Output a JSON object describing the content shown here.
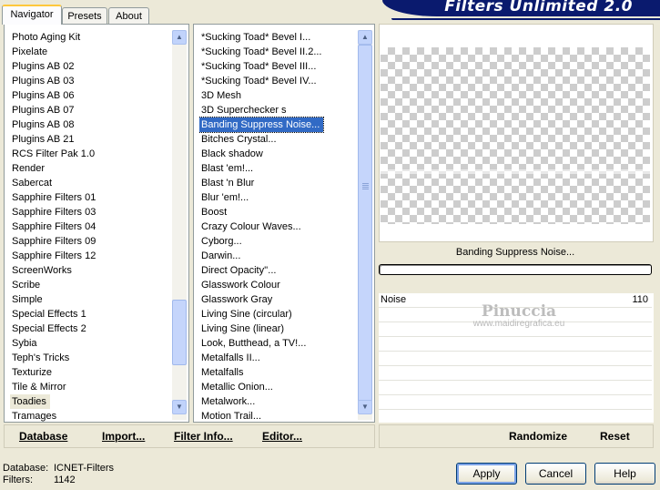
{
  "banner": {
    "title": "Filters Unlimited 2.0"
  },
  "tabs": [
    {
      "label": "Navigator"
    },
    {
      "label": "Presets"
    },
    {
      "label": "About"
    }
  ],
  "categories": [
    "Photo Aging Kit",
    "Pixelate",
    "Plugins AB 02",
    "Plugins AB 03",
    "Plugins AB 06",
    "Plugins AB 07",
    "Plugins AB 08",
    "Plugins AB 21",
    "RCS Filter Pak 1.0",
    "Render",
    "Sabercat",
    "Sapphire Filters 01",
    "Sapphire Filters 03",
    "Sapphire Filters 04",
    "Sapphire Filters 09",
    "Sapphire Filters 12",
    "ScreenWorks",
    "Scribe",
    "Simple",
    "Special Effects 1",
    "Special Effects 2",
    "Sybia",
    "Teph's Tricks",
    "Texturize",
    "Tile & Mirror",
    "Toadies",
    "Tramages"
  ],
  "categories_selected": "Toadies",
  "filters": [
    "*Sucking Toad*  Bevel I...",
    "*Sucking Toad*  Bevel II.2...",
    "*Sucking Toad*  Bevel III...",
    "*Sucking Toad*  Bevel IV...",
    "3D Mesh",
    "3D Superchecker s",
    "Banding Suppress Noise...",
    "Bitches Crystal...",
    "Black shadow",
    "Blast 'em!...",
    "Blast 'n Blur",
    "Blur 'em!...",
    "Boost",
    "Crazy Colour Waves...",
    "Cyborg...",
    "Darwin...",
    "Direct Opacity''...",
    "Glasswork Colour",
    "Glasswork Gray",
    "Living Sine (circular)",
    "Living Sine (linear)",
    "Look, Butthead, a TV!...",
    "Metalfalls II...",
    "Metalfalls",
    "Metallic Onion...",
    "Metalwork...",
    "Motion Trail..."
  ],
  "filters_selected": "Banding Suppress Noise...",
  "bottom_left": {
    "database": "Database",
    "import": "Import...",
    "filter_info": "Filter Info...",
    "editor": "Editor..."
  },
  "preview": {
    "filter_name": "Banding Suppress Noise...",
    "watermark_line1": "Pinuccia",
    "watermark_line2": "www.maidiregrafica.eu"
  },
  "params": [
    {
      "name": "Noise",
      "value": "110"
    }
  ],
  "right_bottom": {
    "randomize": "Randomize",
    "reset": "Reset"
  },
  "status": {
    "database_label": "Database:",
    "database_value": "ICNET-Filters",
    "filters_label": "Filters:",
    "filters_value": "1142"
  },
  "dialog_buttons": {
    "apply": "Apply",
    "cancel": "Cancel",
    "help": "Help"
  },
  "colors": {
    "selection": "#316ac5",
    "banner": "#0a1a6e",
    "tab_accent": "#ffc83c"
  }
}
